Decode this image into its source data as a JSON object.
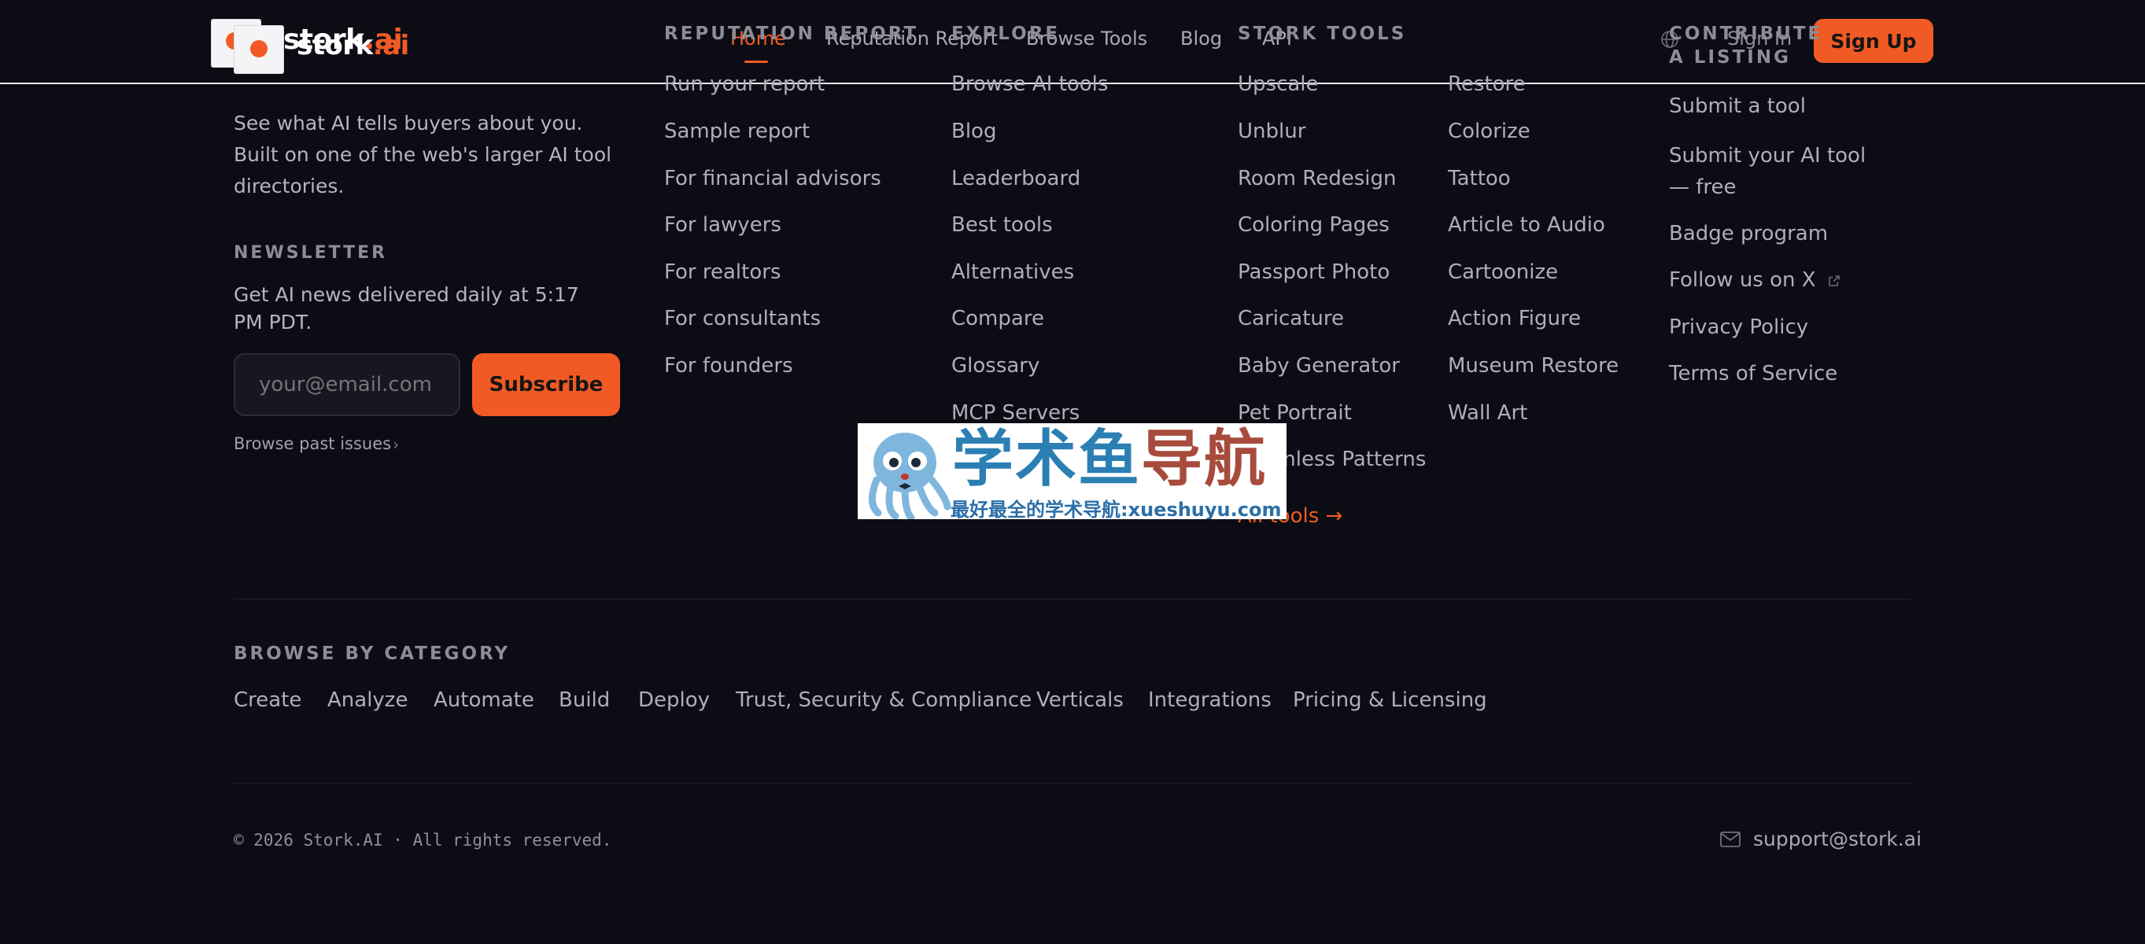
{
  "header": {
    "logo_word": "stork",
    "logo_suffix": ".ai",
    "nav": [
      {
        "label": "Home"
      },
      {
        "label": "Reputation Report"
      },
      {
        "label": "Browse Tools"
      },
      {
        "label": "Blog"
      },
      {
        "label": "API"
      }
    ],
    "sign_in": "Sign In",
    "sign_up": "Sign Up"
  },
  "brand": {
    "tagline": "See what AI tells buyers about you. Built on one of the web's larger AI tool directories."
  },
  "newsletter": {
    "heading": "NEWSLETTER",
    "description": "Get AI news delivered daily at 5:17 PM PDT.",
    "email_placeholder": "your@email.com",
    "subscribe_label": "Subscribe",
    "past_issues": "Browse past issues"
  },
  "columns": {
    "reputation": {
      "heading": "REPUTATION REPORT",
      "links": [
        "Run your report",
        "Sample report",
        "For financial advisors",
        "For lawyers",
        "For realtors",
        "For consultants",
        "For founders"
      ]
    },
    "explore": {
      "heading": "EXPLORE",
      "links": [
        "Browse AI tools",
        "Blog",
        "Leaderboard",
        "Best tools",
        "Alternatives",
        "Compare",
        "Glossary",
        "MCP Servers"
      ]
    },
    "stork_tools": {
      "heading": "STORK TOOLS",
      "left": [
        "Upscale",
        "Unblur",
        "Room Redesign",
        "Coloring Pages",
        "Passport Photo",
        "Caricature",
        "Baby Generator",
        "Pet Portrait",
        "Seamless Patterns"
      ],
      "right": [
        "Restore",
        "Colorize",
        "Tattoo",
        "Article to Audio",
        "Cartoonize",
        "Action Figure",
        "Museum Restore",
        "Wall Art"
      ],
      "all_tools": "All tools →"
    },
    "contribute": {
      "heading_line1": "CONTRIBUTE",
      "heading_line2": "A LISTING",
      "links": [
        "Submit a tool",
        "Submit your AI tool — free",
        "Badge program",
        "Follow us on X",
        "Privacy Policy",
        "Terms of Service"
      ]
    }
  },
  "categories": {
    "heading": "BROWSE BY CATEGORY",
    "items": [
      "Create",
      "Analyze",
      "Automate",
      "Build",
      "Deploy",
      "Trust, Security & Compliance",
      "Verticals",
      "Integrations",
      "Pricing & Licensing"
    ]
  },
  "footer": {
    "copyright": "© 2026 Stork.AI · All rights reserved.",
    "support_email": "support@stork.ai"
  },
  "watermark": {
    "title_part1": "学术鱼",
    "title_part2": "导航",
    "subtitle": "最好最全的学术导航:xueshuyu.com"
  },
  "colors": {
    "background": "#0b0c14",
    "accent": "#f15a24",
    "text_muted": "#aeafb9"
  }
}
